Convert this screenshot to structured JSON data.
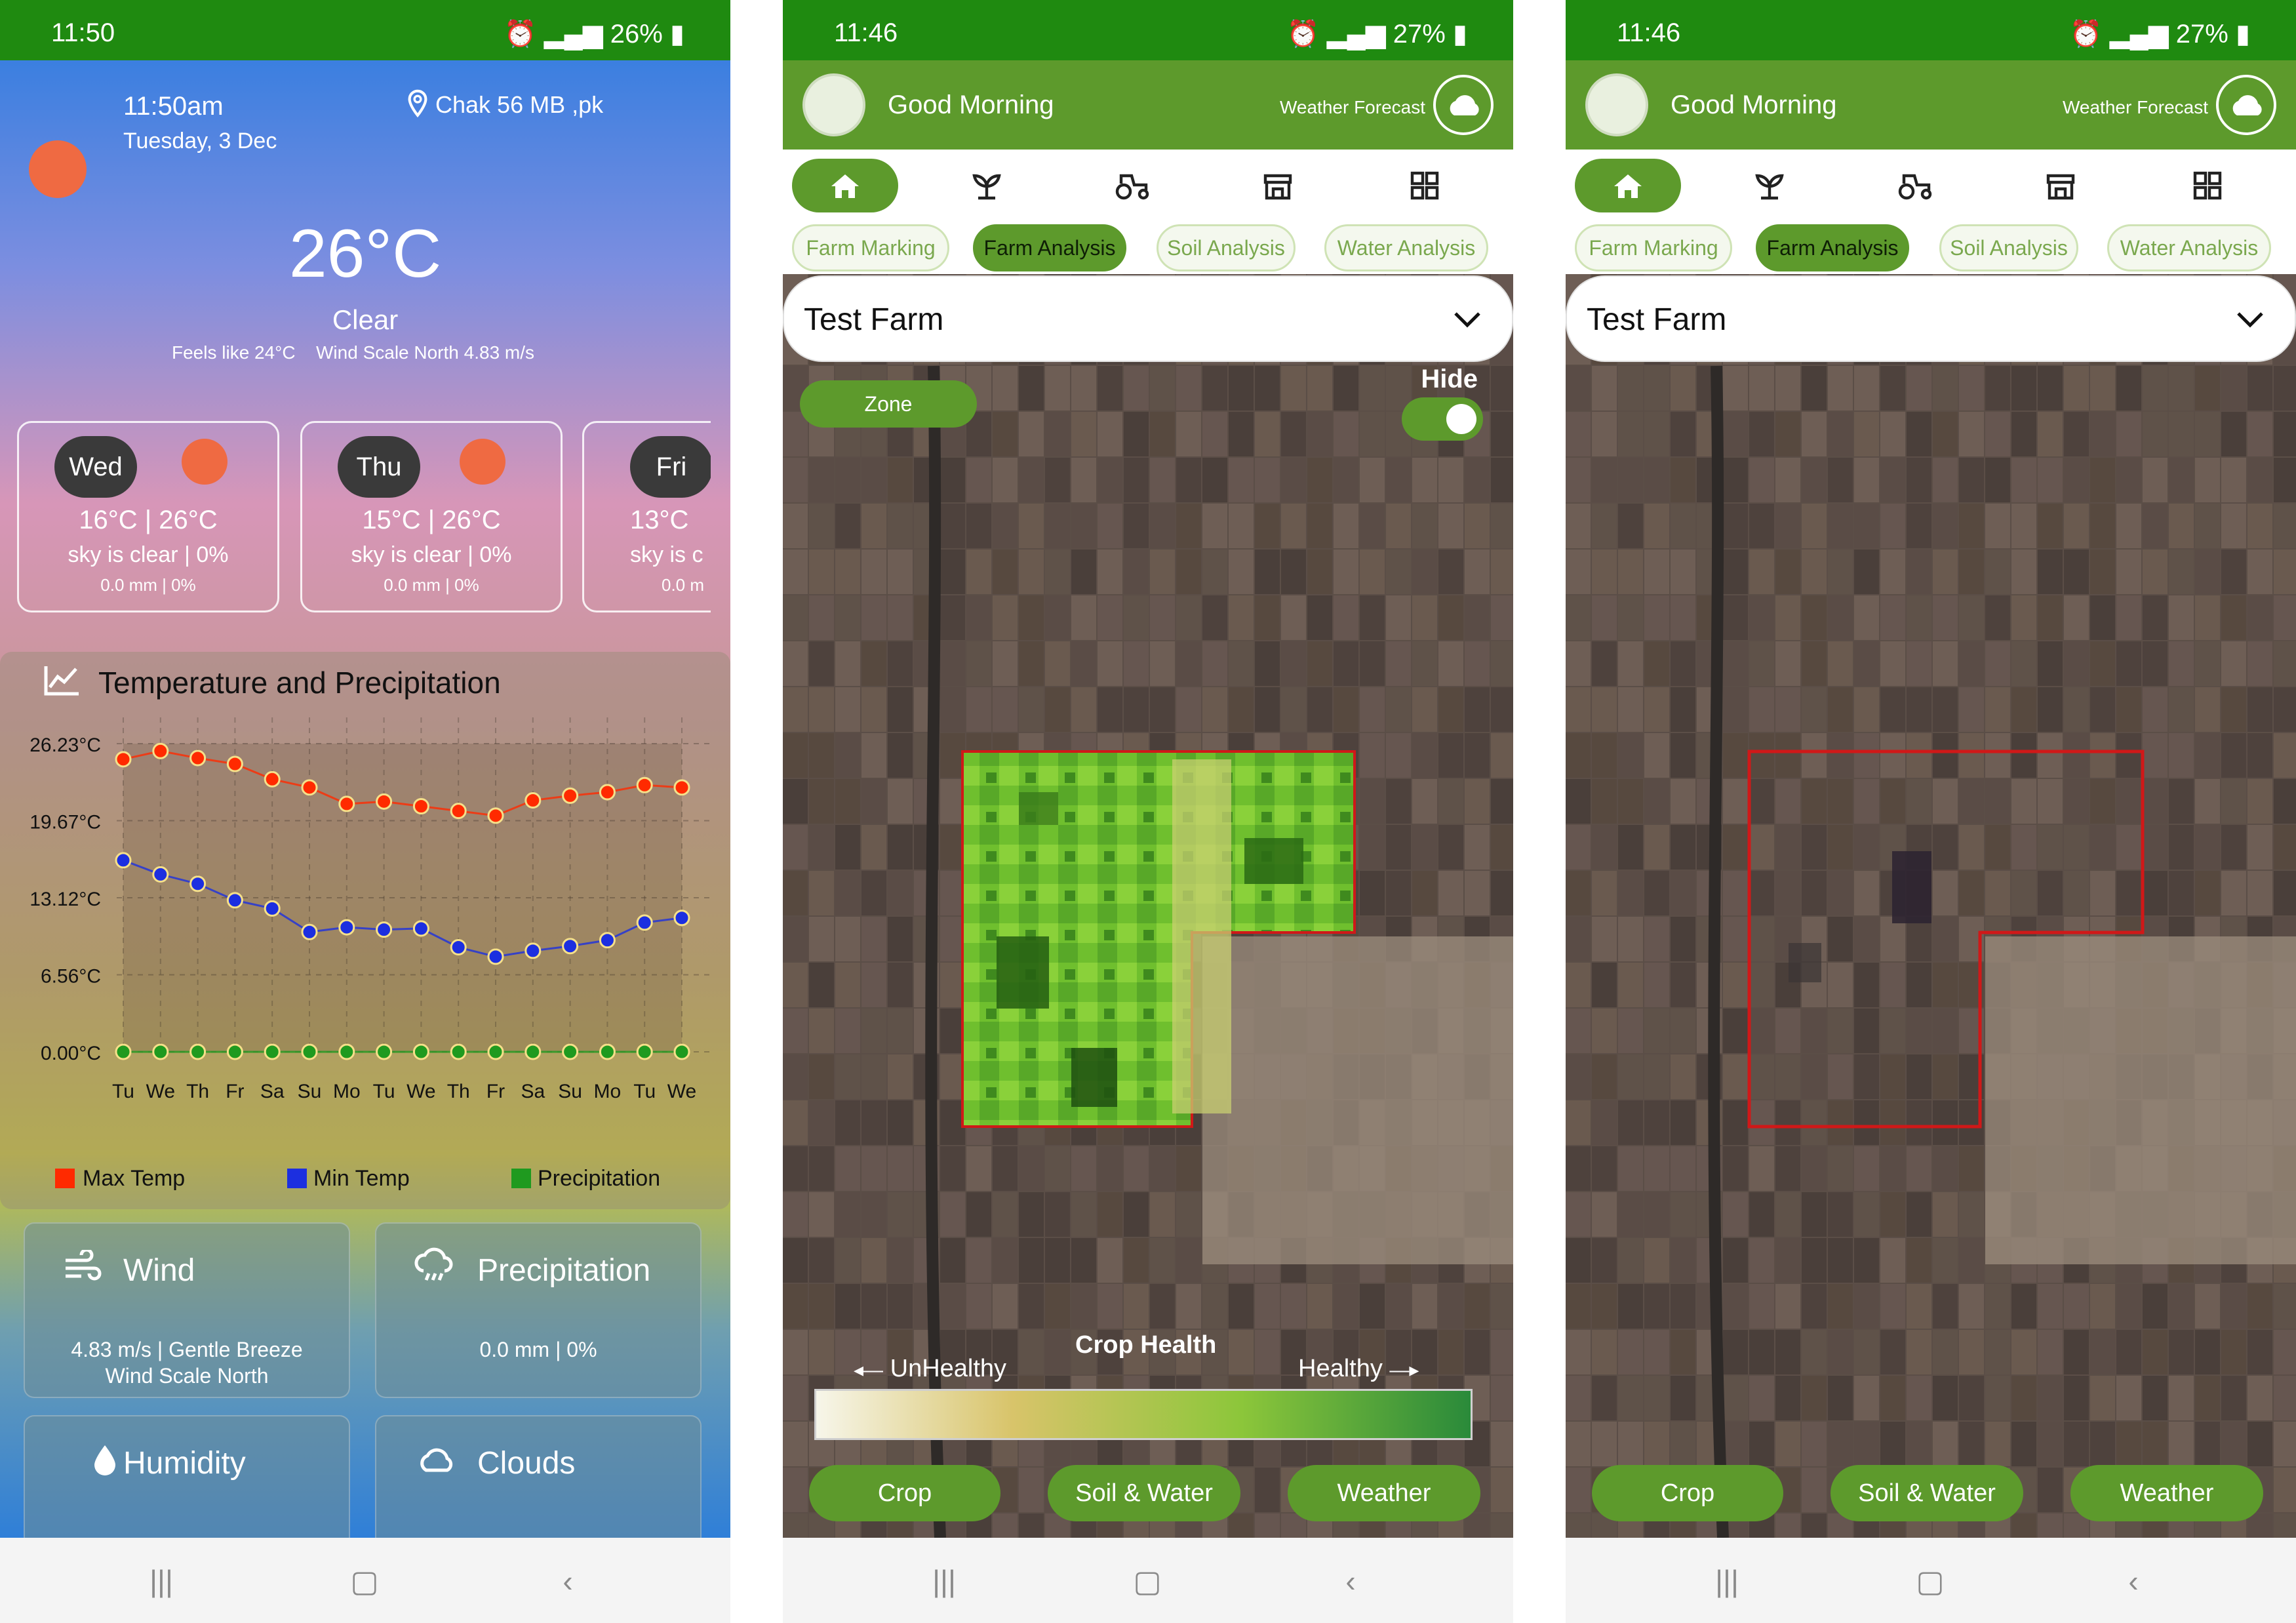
{
  "screen1": {
    "status": {
      "time": "11:50",
      "battery": "26%"
    },
    "weather": {
      "time": "11:50am",
      "date": "Tuesday, 3 Dec",
      "location": "Chak 56 MB ,pk",
      "temp": "26°C",
      "condition": "Clear",
      "feels_like": "Feels like 24°C",
      "wind_scale": "Wind Scale North 4.83 m/s"
    },
    "days": [
      {
        "day": "Wed",
        "range": "16°C | 26°C",
        "desc": "sky is clear |  0%",
        "precip": "0.0 mm | 0%"
      },
      {
        "day": "Thu",
        "range": "15°C | 26°C",
        "desc": "sky is clear |  0%",
        "precip": "0.0 mm | 0%"
      },
      {
        "day": "Fri",
        "range": "13°C",
        "desc": "sky is c",
        "precip": "0.0 m"
      }
    ],
    "panel_title": "Temperature and Precipitation",
    "tiles": {
      "wind": {
        "title": "Wind",
        "line1": "4.83 m/s | Gentle Breeze",
        "line2": "Wind Scale North"
      },
      "precip": {
        "title": "Precipitation",
        "line1": "0.0 mm | 0%"
      },
      "humidity": {
        "title": "Humidity"
      },
      "clouds": {
        "title": "Clouds"
      }
    }
  },
  "screen2": {
    "status": {
      "time": "11:46",
      "battery": "27%"
    },
    "greeting": "Good Morning",
    "weather_forecast": "Weather Forecast",
    "tabs": [
      "Farm Marking",
      "Farm Analysis",
      "Soil Analysis",
      "Water Analysis"
    ],
    "farm_name": "Test Farm",
    "zone_label": "Zone",
    "hide_label": "Hide",
    "legend": {
      "title": "Crop Health",
      "unhealthy": "UnHealthy",
      "healthy": "Healthy"
    },
    "bottom_buttons": [
      "Crop",
      "Soil & Water",
      "Weather"
    ]
  },
  "screen3": {
    "status": {
      "time": "11:46",
      "battery": "27%"
    },
    "greeting": "Good Morning",
    "weather_forecast": "Weather Forecast",
    "tabs": [
      "Farm Marking",
      "Farm Analysis",
      "Soil Analysis",
      "Water Analysis"
    ],
    "farm_name": "Test Farm",
    "bottom_buttons": [
      "Crop",
      "Soil & Water",
      "Weather"
    ]
  },
  "colors": {
    "brand_green": "#5d9a2c",
    "status_green": "#1f8a10",
    "max_temp": "#ff2a00",
    "min_temp": "#1c2fe0",
    "precipitation": "#1f9a1f",
    "farm_outline": "#d01818"
  },
  "chart_data": {
    "type": "line",
    "title": "Temperature and Precipitation",
    "categories": [
      "Tu",
      "We",
      "Th",
      "Fr",
      "Sa",
      "Su",
      "Mo",
      "Tu",
      "We",
      "Th",
      "Fr",
      "Sa",
      "Su",
      "Mo",
      "Tu",
      "We"
    ],
    "y_ticks": [
      "26.23°C",
      "19.67°C",
      "13.12°C",
      "6.56°C",
      "0.00°C"
    ],
    "ylim": [
      0,
      26.23
    ],
    "series": [
      {
        "name": "Max Temp",
        "values": [
          24.9,
          25.6,
          25.0,
          24.5,
          23.2,
          22.5,
          21.1,
          21.3,
          20.9,
          20.5,
          20.1,
          21.4,
          21.8,
          22.1,
          22.7,
          22.5
        ]
      },
      {
        "name": "Min Temp",
        "values": [
          16.3,
          15.1,
          14.3,
          12.9,
          12.2,
          10.2,
          10.6,
          10.4,
          10.5,
          8.9,
          8.1,
          8.6,
          9.0,
          9.5,
          11.0,
          11.4
        ]
      },
      {
        "name": "Precipitation",
        "values": [
          0,
          0,
          0,
          0,
          0,
          0,
          0,
          0,
          0,
          0,
          0,
          0,
          0,
          0,
          0,
          0
        ]
      }
    ],
    "legend_position": "bottom",
    "grid": true
  }
}
